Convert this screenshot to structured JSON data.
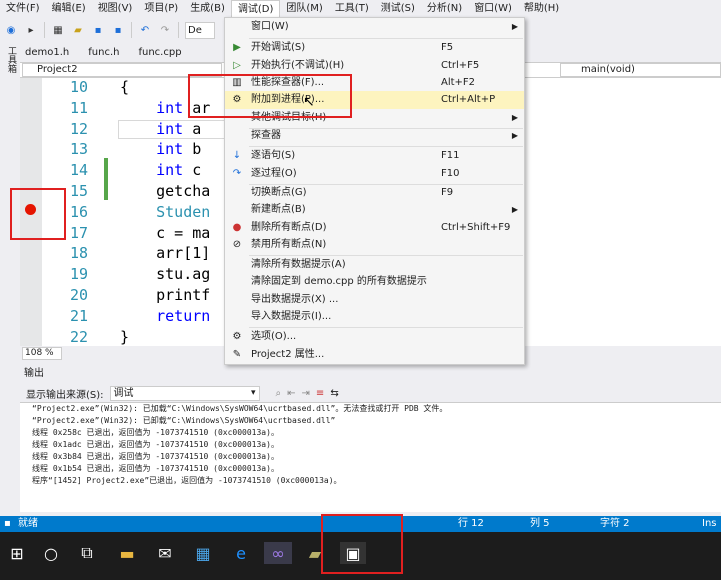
{
  "menubar": [
    "文件(F)",
    "编辑(E)",
    "视图(V)",
    "项目(P)",
    "生成(B)",
    "调试(D)",
    "团队(M)",
    "工具(T)",
    "测试(S)",
    "分析(N)",
    "窗口(W)",
    "帮助(H)"
  ],
  "toolbar": {
    "config": "De"
  },
  "left_strip": "工具箱",
  "tabs": [
    "demo1.h",
    "func.h",
    "func.cpp"
  ],
  "nav": {
    "project": "Project2",
    "function": "main(void)"
  },
  "line_numbers": [
    "10",
    "11",
    "12",
    "13",
    "14",
    "15",
    "16",
    "17",
    "18",
    "19",
    "20",
    "21",
    "22"
  ],
  "code": [
    "{",
    "    int ar",
    "    int a ",
    "    int b ",
    "    int c ",
    "    getcha",
    "    Studen",
    "    c = ma",
    "    arr[1]",
    "    stu.ag",
    "    printf",
    "    return",
    "}"
  ],
  "zoom": "108 %",
  "output": {
    "title": "输出",
    "source_label": "显示输出来源(S):",
    "source_value": "调试",
    "lines": [
      "“Project2.exe”(Win32): 已加载“C:\\Windows\\SysWOW64\\ucrtbased.dll”。无法查找或打开 PDB 文件。",
      "“Project2.exe”(Win32): 已卸载“C:\\Windows\\SysWOW64\\ucrtbased.dll”",
      "线程 0x258c 已退出，返回值为 -1073741510 (0xc000013a)。",
      "线程 0x1adc 已退出，返回值为 -1073741510 (0xc000013a)。",
      "线程 0x3b84 已退出，返回值为 -1073741510 (0xc000013a)。",
      "线程 0x1b54 已退出，返回值为 -1073741510 (0xc000013a)。",
      "程序“[1452] Project2.exe”已退出，返回值为 -1073741510 (0xc000013a)。"
    ]
  },
  "status": {
    "ready": "就绪",
    "row": "行 12",
    "col": "列 5",
    "char": "字符 2",
    "mode": "Ins"
  },
  "debug_menu": [
    {
      "label": "窗口(W)",
      "shortcut": "",
      "arrow": true
    },
    {
      "label": "开始调试(S)",
      "shortcut": "F5",
      "icon": "play-icon"
    },
    {
      "label": "开始执行(不调试)(H)",
      "shortcut": "Ctrl+F5",
      "icon": "play-outline-icon"
    },
    {
      "label": "性能探查器(F)...",
      "shortcut": "Alt+F2",
      "icon": "profiler-icon"
    },
    {
      "label": "附加到进程(P)...",
      "shortcut": "Ctrl+Alt+P",
      "icon": "attach-icon",
      "highlighted": true
    },
    {
      "label": "其他调试目标(H)",
      "shortcut": "",
      "arrow": true
    },
    {
      "label": "探查器",
      "shortcut": "",
      "arrow": true
    },
    {
      "label": "逐语句(S)",
      "shortcut": "F11",
      "icon": "step-into-icon"
    },
    {
      "label": "逐过程(O)",
      "shortcut": "F10",
      "icon": "step-over-icon"
    },
    {
      "label": "切换断点(G)",
      "shortcut": "F9"
    },
    {
      "label": "新建断点(B)",
      "shortcut": "",
      "arrow": true
    },
    {
      "label": "删除所有断点(D)",
      "shortcut": "Ctrl+Shift+F9",
      "icon": "delete-breakpoints-icon"
    },
    {
      "label": "禁用所有断点(N)",
      "shortcut": "",
      "icon": "disable-breakpoints-icon"
    },
    {
      "label": "清除所有数据提示(A)",
      "shortcut": ""
    },
    {
      "label": "清除固定到 demo.cpp 的所有数据提示",
      "shortcut": ""
    },
    {
      "label": "导出数据提示(X) ...",
      "shortcut": ""
    },
    {
      "label": "导入数据提示(I)...",
      "shortcut": ""
    },
    {
      "label": "选项(O)...",
      "shortcut": "",
      "icon": "gear-icon"
    },
    {
      "label": "Project2 属性...",
      "shortcut": "",
      "icon": "wrench-icon"
    }
  ]
}
